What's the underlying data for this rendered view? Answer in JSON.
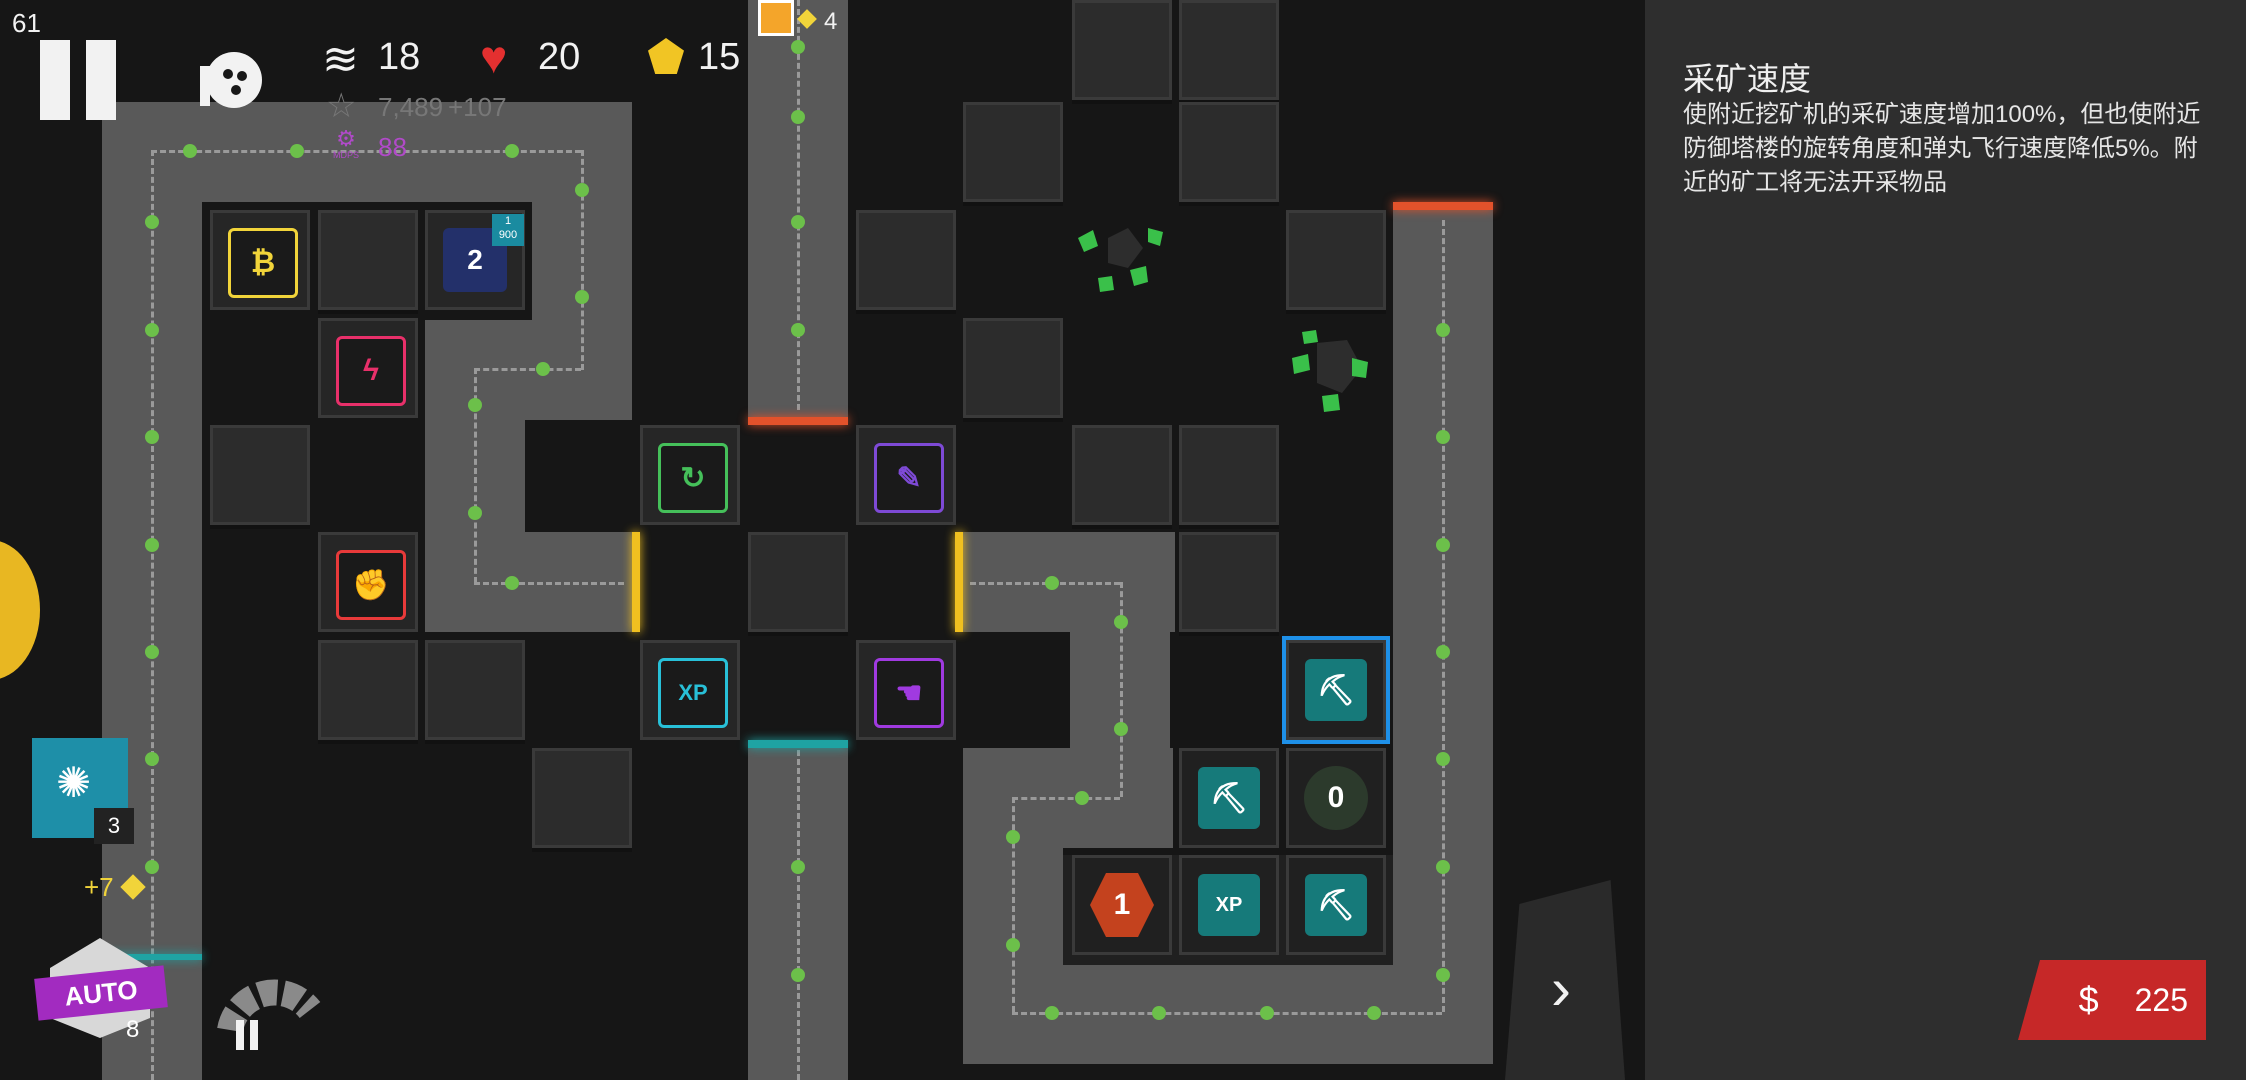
{
  "hud": {
    "fps": "61",
    "wave": "18",
    "lives": "20",
    "gems": "15",
    "score": "7,489",
    "score_bonus": "+107",
    "mdps_value": "88",
    "mdps_label": "MDPS",
    "top_resource_count": "4"
  },
  "colors": {
    "path": "#595959",
    "node_green": "#6cc04a",
    "gate_orange": "#e2522b",
    "gate_yellow": "#f0c020",
    "gate_teal": "#1fa3a3",
    "selected_blue": "#1e90e8",
    "buy_red": "#c62828",
    "miner_teal": "#167a7a"
  },
  "board": {
    "tower_bank_count": "2",
    "tower_bank_badge_top": "1",
    "tower_bank_badge_bottom": "900",
    "xp_tower_label": "XP",
    "selected_tower_icon": "pickaxe-icon",
    "mine_counter": "0",
    "hex_tower_label": "1",
    "xp_miner_label": "XP"
  },
  "left_controls": {
    "ability_count": "3",
    "gem_income": "+7",
    "auto_label": "AUTO",
    "auto_count": "8"
  },
  "panel": {
    "title": "采矿速度",
    "description": "使附近挖矿机的采矿速度增加100%，但也使附近防御塔楼的旋转角度和弹丸飞行速度降低5%。附近的矿工将无法开采物品",
    "buy_price": "225",
    "currency_symbol": "$"
  }
}
